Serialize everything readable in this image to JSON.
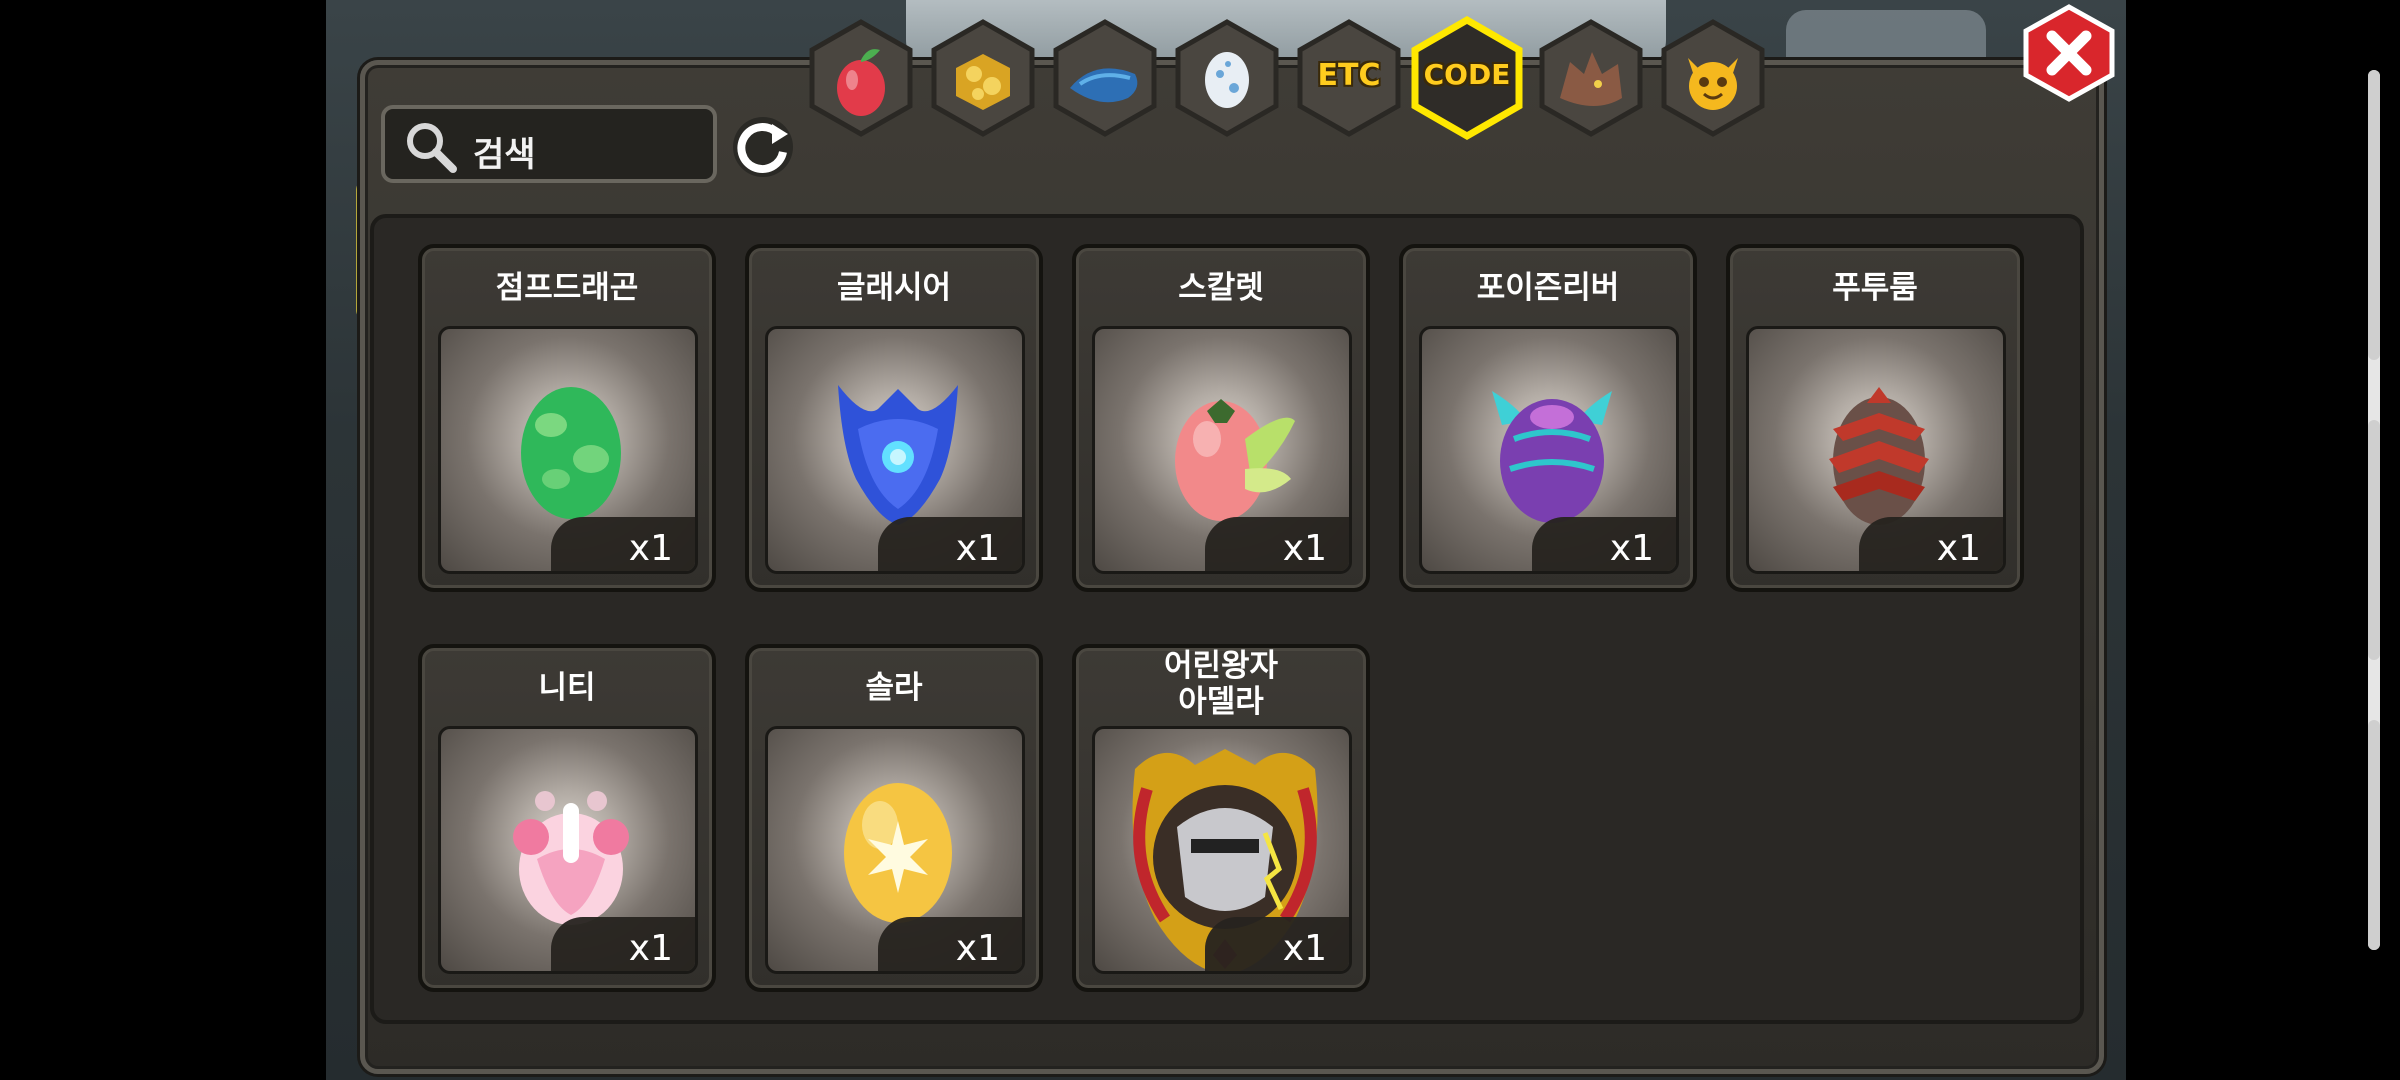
{
  "search": {
    "placeholder": "검색"
  },
  "tabs": [
    {
      "name": "fruit",
      "icon": "fruit-icon"
    },
    {
      "name": "gold",
      "icon": "gold-ore-icon"
    },
    {
      "name": "fish",
      "icon": "fish-icon"
    },
    {
      "name": "egg",
      "icon": "egg-icon"
    },
    {
      "name": "etc",
      "label": "ETC"
    },
    {
      "name": "code",
      "label": "CODE",
      "selected": true
    },
    {
      "name": "dragon",
      "icon": "dragon-head-icon"
    },
    {
      "name": "mascot",
      "icon": "mascot-face-icon"
    }
  ],
  "eggs": [
    {
      "name": "점프드래곤",
      "qty": "x1",
      "icon": "green-egg-icon",
      "color": "#2fb85a"
    },
    {
      "name": "글래시어",
      "qty": "x1",
      "icon": "glacier-egg-icon",
      "color": "#2f52d9"
    },
    {
      "name": "스칼렛",
      "qty": "x1",
      "icon": "scarlet-egg-icon",
      "color": "#f2898a"
    },
    {
      "name": "포이즌리버",
      "qty": "x1",
      "icon": "poison-river-egg-icon",
      "color": "#7a3fb0"
    },
    {
      "name": "푸투룸",
      "qty": "x1",
      "icon": "futurum-egg-icon",
      "color": "#c0392b"
    },
    {
      "name": "니티",
      "qty": "x1",
      "icon": "niti-egg-icon",
      "color": "#f5a3c0"
    },
    {
      "name": "솔라",
      "qty": "x1",
      "icon": "solar-egg-icon",
      "color": "#f5c542"
    },
    {
      "name": "어린왕자\n아델라",
      "qty": "x1",
      "icon": "little-prince-adela-egg-icon",
      "color": "#d4a017"
    }
  ],
  "colors": {
    "tab_selected_border": "#ffe800",
    "tab_label": "#ffcc1e",
    "close_button": "#d9262c"
  }
}
